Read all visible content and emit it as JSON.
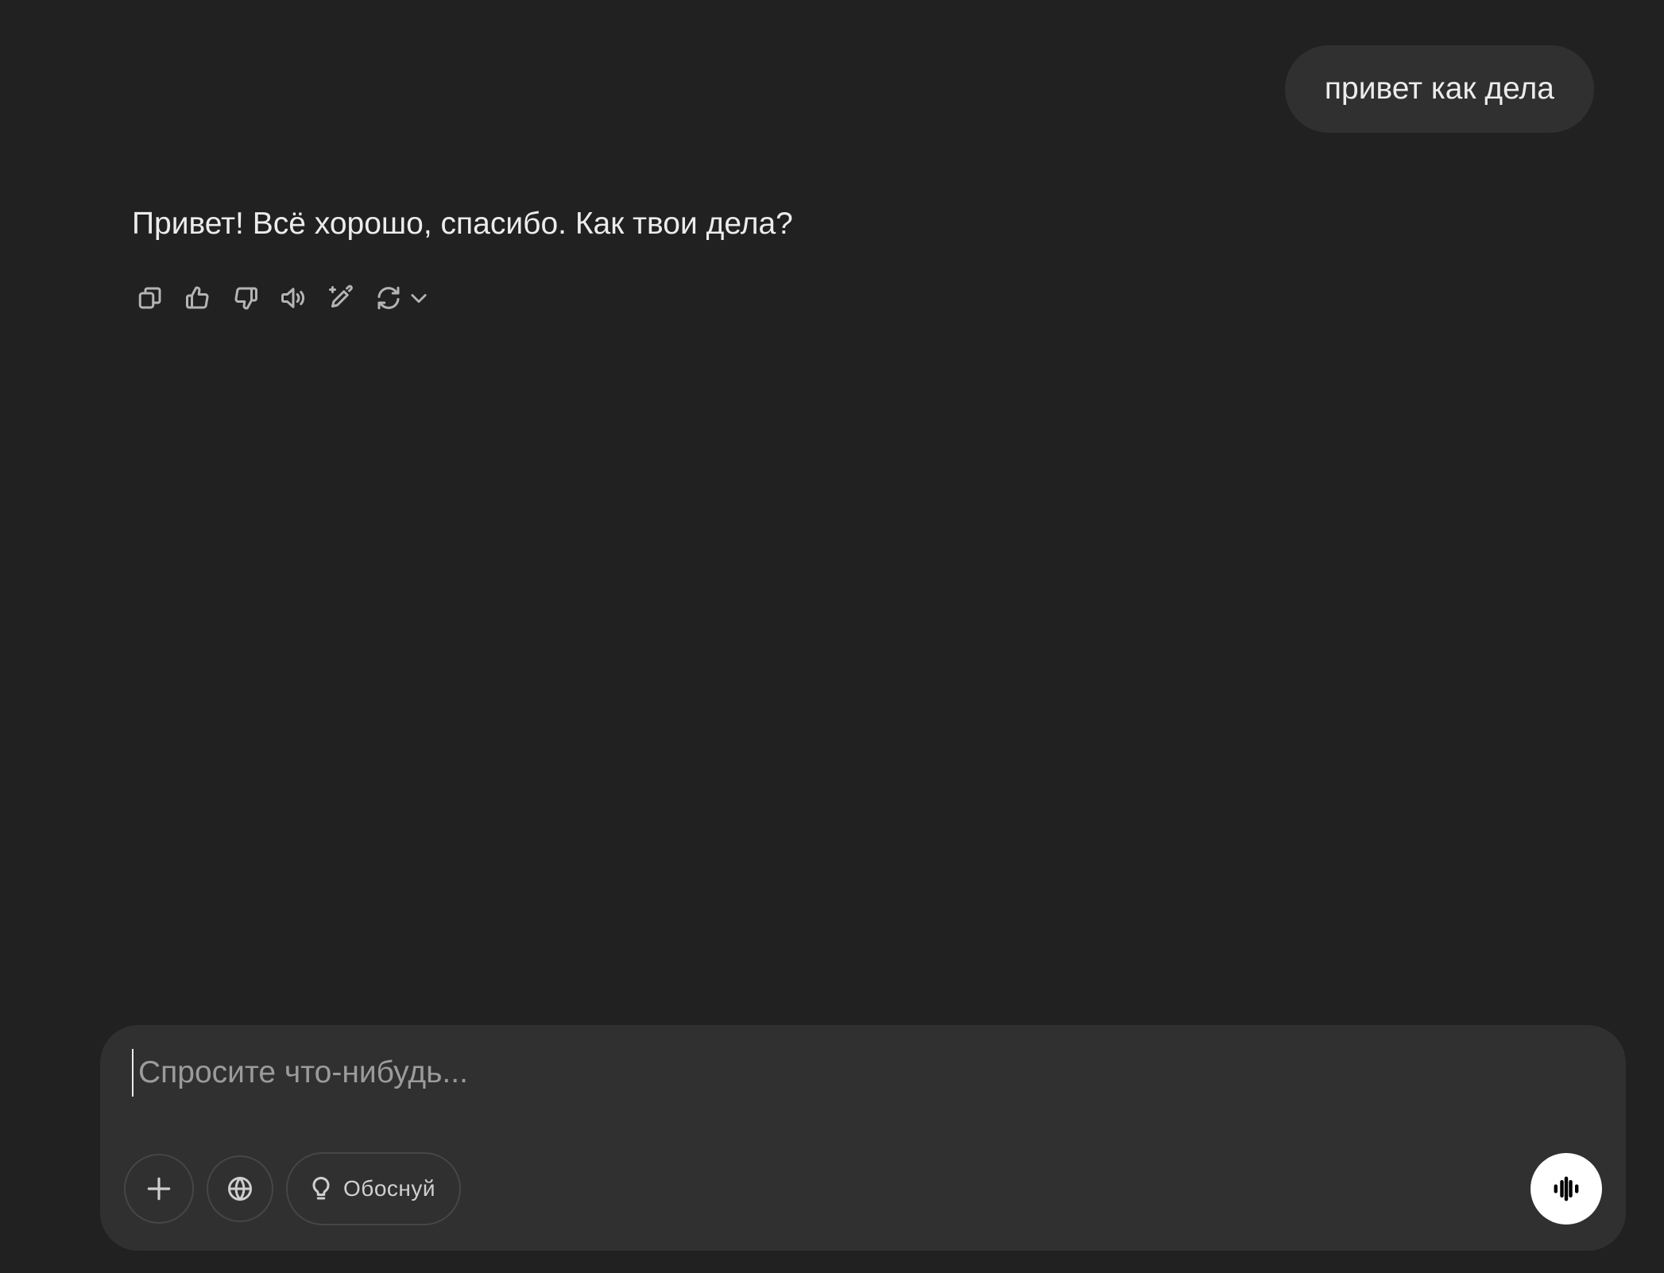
{
  "conversation": {
    "user_message": "привет как дела",
    "assistant_message": "Привет! Всё хорошо, спасибо. Как твои дела?"
  },
  "message_actions": [
    {
      "name": "copy",
      "icon": "copy-icon"
    },
    {
      "name": "like",
      "icon": "thumbs-up-icon"
    },
    {
      "name": "dislike",
      "icon": "thumbs-down-icon"
    },
    {
      "name": "read-aloud",
      "icon": "speaker-icon"
    },
    {
      "name": "edit",
      "icon": "edit-sparkle-icon"
    },
    {
      "name": "regenerate",
      "icon": "refresh-icon"
    }
  ],
  "composer": {
    "placeholder": "Спросите что-нибудь...",
    "value": "",
    "tools": {
      "attach_icon": "plus-icon",
      "search_icon": "globe-icon",
      "reason_icon": "lightbulb-icon",
      "reason_label": "Обоснуй"
    },
    "voice_icon": "voice-wave-icon"
  },
  "colors": {
    "background": "#212121",
    "surface": "#303030",
    "text": "#ececec",
    "muted": "#b4b4b4",
    "voice_button": "#ffffff"
  }
}
